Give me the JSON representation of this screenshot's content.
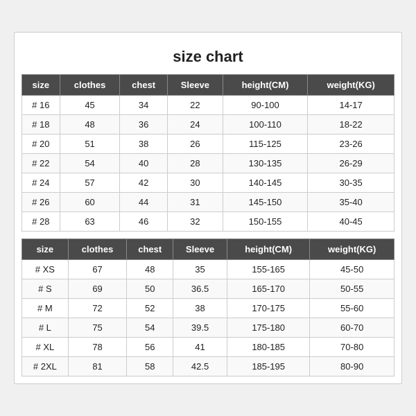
{
  "title": "size chart",
  "table1": {
    "headers": [
      "size",
      "clothes",
      "chest",
      "Sleeve",
      "height(CM)",
      "weight(KG)"
    ],
    "rows": [
      [
        "# 16",
        "45",
        "34",
        "22",
        "90-100",
        "14-17"
      ],
      [
        "# 18",
        "48",
        "36",
        "24",
        "100-110",
        "18-22"
      ],
      [
        "# 20",
        "51",
        "38",
        "26",
        "115-125",
        "23-26"
      ],
      [
        "# 22",
        "54",
        "40",
        "28",
        "130-135",
        "26-29"
      ],
      [
        "# 24",
        "57",
        "42",
        "30",
        "140-145",
        "30-35"
      ],
      [
        "# 26",
        "60",
        "44",
        "31",
        "145-150",
        "35-40"
      ],
      [
        "# 28",
        "63",
        "46",
        "32",
        "150-155",
        "40-45"
      ]
    ]
  },
  "table2": {
    "headers": [
      "size",
      "clothes",
      "chest",
      "Sleeve",
      "height(CM)",
      "weight(KG)"
    ],
    "rows": [
      [
        "# XS",
        "67",
        "48",
        "35",
        "155-165",
        "45-50"
      ],
      [
        "# S",
        "69",
        "50",
        "36.5",
        "165-170",
        "50-55"
      ],
      [
        "# M",
        "72",
        "52",
        "38",
        "170-175",
        "55-60"
      ],
      [
        "# L",
        "75",
        "54",
        "39.5",
        "175-180",
        "60-70"
      ],
      [
        "# XL",
        "78",
        "56",
        "41",
        "180-185",
        "70-80"
      ],
      [
        "# 2XL",
        "81",
        "58",
        "42.5",
        "185-195",
        "80-90"
      ]
    ]
  }
}
